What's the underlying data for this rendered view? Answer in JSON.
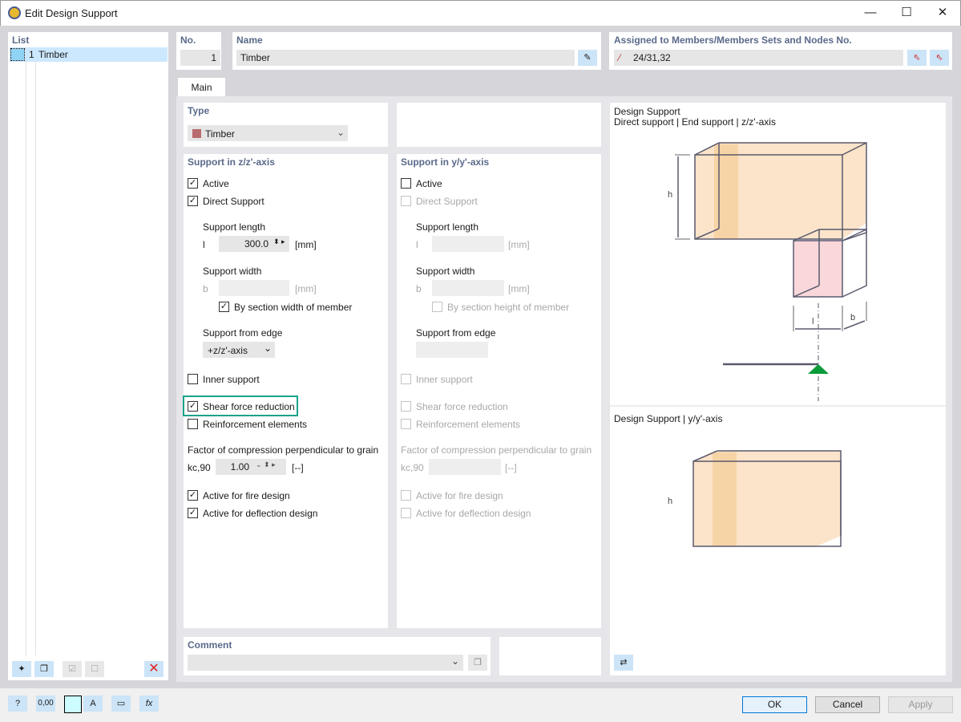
{
  "window": {
    "title": "Edit Design Support",
    "minimize": "—",
    "maximize": "☐",
    "close": "✕"
  },
  "list": {
    "header": "List",
    "items": [
      {
        "no": "1",
        "name": "Timber",
        "color": "#8fd3f5"
      }
    ]
  },
  "no": {
    "label": "No.",
    "value": "1"
  },
  "name": {
    "label": "Name",
    "value": "Timber"
  },
  "assigned": {
    "label": "Assigned to Members/Members Sets and Nodes No.",
    "value": "24/31,32"
  },
  "tabs": [
    {
      "label": "Main",
      "active": true
    }
  ],
  "type": {
    "label": "Type",
    "value": "Timber",
    "color": "#b86c6c"
  },
  "z": {
    "header": "Support in z/z'-axis",
    "active": {
      "label": "Active",
      "checked": true
    },
    "direct": {
      "label": "Direct Support",
      "checked": true
    },
    "support_length": {
      "label": "Support length",
      "symbol": "l",
      "value": "300.0",
      "unit": "[mm]"
    },
    "support_width": {
      "label": "Support width",
      "symbol": "b",
      "value": "",
      "unit": "[mm]"
    },
    "by_section": {
      "label": "By section width of member",
      "checked": true
    },
    "from_edge": {
      "label": "Support from edge",
      "value": "+z/z'-axis"
    },
    "inner": {
      "label": "Inner support",
      "checked": false
    },
    "shear": {
      "label": "Shear force reduction",
      "checked": true,
      "highlight": "#1aa38a"
    },
    "reinf": {
      "label": "Reinforcement elements",
      "checked": false
    },
    "factor": {
      "label": "Factor of compression perpendicular to grain",
      "symbol": "kc,90",
      "value": "1.00",
      "unit": "[--]"
    },
    "fire": {
      "label": "Active for fire design",
      "checked": true
    },
    "deflection": {
      "label": "Active for deflection design",
      "checked": true
    }
  },
  "y": {
    "header": "Support in y/y'-axis",
    "active": {
      "label": "Active",
      "checked": false
    },
    "direct": {
      "label": "Direct Support",
      "checked": false
    },
    "support_length": {
      "label": "Support length",
      "symbol": "l",
      "unit": "[mm]"
    },
    "support_width": {
      "label": "Support width",
      "symbol": "b",
      "unit": "[mm]"
    },
    "by_section": {
      "label": "By section height of member",
      "checked": false
    },
    "from_edge": {
      "label": "Support from edge"
    },
    "inner": {
      "label": "Inner support"
    },
    "shear": {
      "label": "Shear force reduction"
    },
    "reinf": {
      "label": "Reinforcement elements"
    },
    "factor": {
      "label": "Factor of compression perpendicular to grain",
      "symbol": "kc,90",
      "unit": "[--]"
    },
    "fire": {
      "label": "Active for fire design"
    },
    "deflection": {
      "label": "Active for deflection design"
    }
  },
  "comment": {
    "label": "Comment",
    "value": ""
  },
  "preview": {
    "title1": "Design Support",
    "subtitle1": "Direct support | End support | z/z'-axis",
    "title2": "Design Support | y/y'-axis",
    "h": "h",
    "l": "l",
    "b": "b"
  },
  "buttons": {
    "ok": "OK",
    "cancel": "Cancel",
    "apply": "Apply"
  },
  "toolbar": {
    "units": "0,00"
  }
}
